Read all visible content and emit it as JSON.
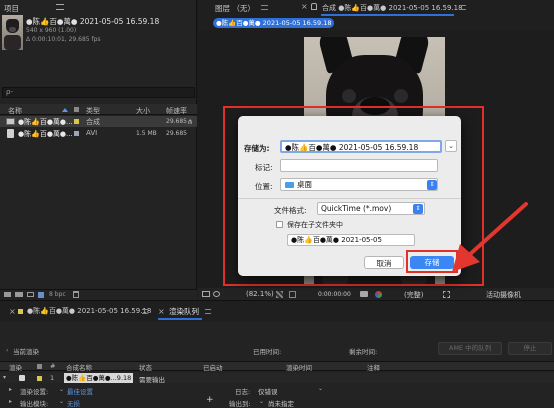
{
  "project_panel": {
    "title": "项目",
    "comp_name": "●陈👍百●萬● 2021-05-05 16.59.18",
    "comp_size": "540 x 960 (1.00)",
    "comp_duration": "Δ 0:00:10:01, 29.685 fps",
    "search_placeholder": "ρ-",
    "columns": {
      "name": "名称",
      "type": "类型",
      "size": "大小",
      "fps": "帧速率"
    },
    "items": [
      {
        "name": "●陈👍百●萬●...",
        "type": "合成",
        "size": "",
        "fps": "29.685"
      },
      {
        "name": "●陈👍百●萬●...",
        "type": "AVI",
        "size": "1.5 MB",
        "fps": "29.685"
      }
    ],
    "bpc_label": "8 bpc"
  },
  "layer_tab": {
    "label": "图层 （无）"
  },
  "comp_viewer": {
    "tab_label": "合成 ●陈👍百●萬● 2021-05-05 16.59.18",
    "breadcrumb": "●陈👍百●萬● 2021-05-05 16.59.18",
    "zoom": "(82.1%)",
    "timecode": "0:00:00:00",
    "quality": "(完整)",
    "camera": "活动摄像机"
  },
  "save_dialog": {
    "save_as_label": "存储为:",
    "save_as_value": "●陈👍百●萬● 2021-05-05 16.59.18",
    "tags_label": "标记:",
    "location_label": "位置:",
    "location_value": "桌面",
    "format_label": "文件格式:",
    "format_value": "QuickTime (*.mov)",
    "subfolder_label": "保存在子文件夹中",
    "subfolder_value": "●陈👍百●萬● 2021-05-05",
    "cancel_label": "取消",
    "save_label": "存储"
  },
  "render_tabs": {
    "comp_tab": "●陈👍百●萬● 2021-05-05 16.59.18",
    "render_queue_tab": "渲染队列"
  },
  "render_queue": {
    "current_render_label": "当前渲染",
    "elapsed_label": "已用时间:",
    "remaining_label": "剩余时间:",
    "ame_queue_button": "AME 中的队列",
    "stop_button": "停止",
    "columns": {
      "render": "渲染",
      "tag": "",
      "num": "#",
      "comp_name": "合成名称",
      "status": "状态",
      "started": "已启动",
      "render_time": "渲染时间",
      "comment": "注释"
    },
    "item": {
      "num": "1",
      "comp_name": "●陈👍百●萬●...9.18",
      "status": "需要输出"
    },
    "render_settings_label": "渲染设置:",
    "render_settings_value": "最佳设置",
    "output_module_label": "输出模块:",
    "output_module_value": "无损",
    "log_label": "日志:",
    "log_value": "仅错误",
    "output_to_label": "输出到:",
    "output_to_value": "尚未指定"
  },
  "colors": {
    "accent": "#2e6fd8",
    "highlight_border": "#e0302a",
    "arrow": "#e2362e",
    "label_yellow": "#d9c74c"
  }
}
